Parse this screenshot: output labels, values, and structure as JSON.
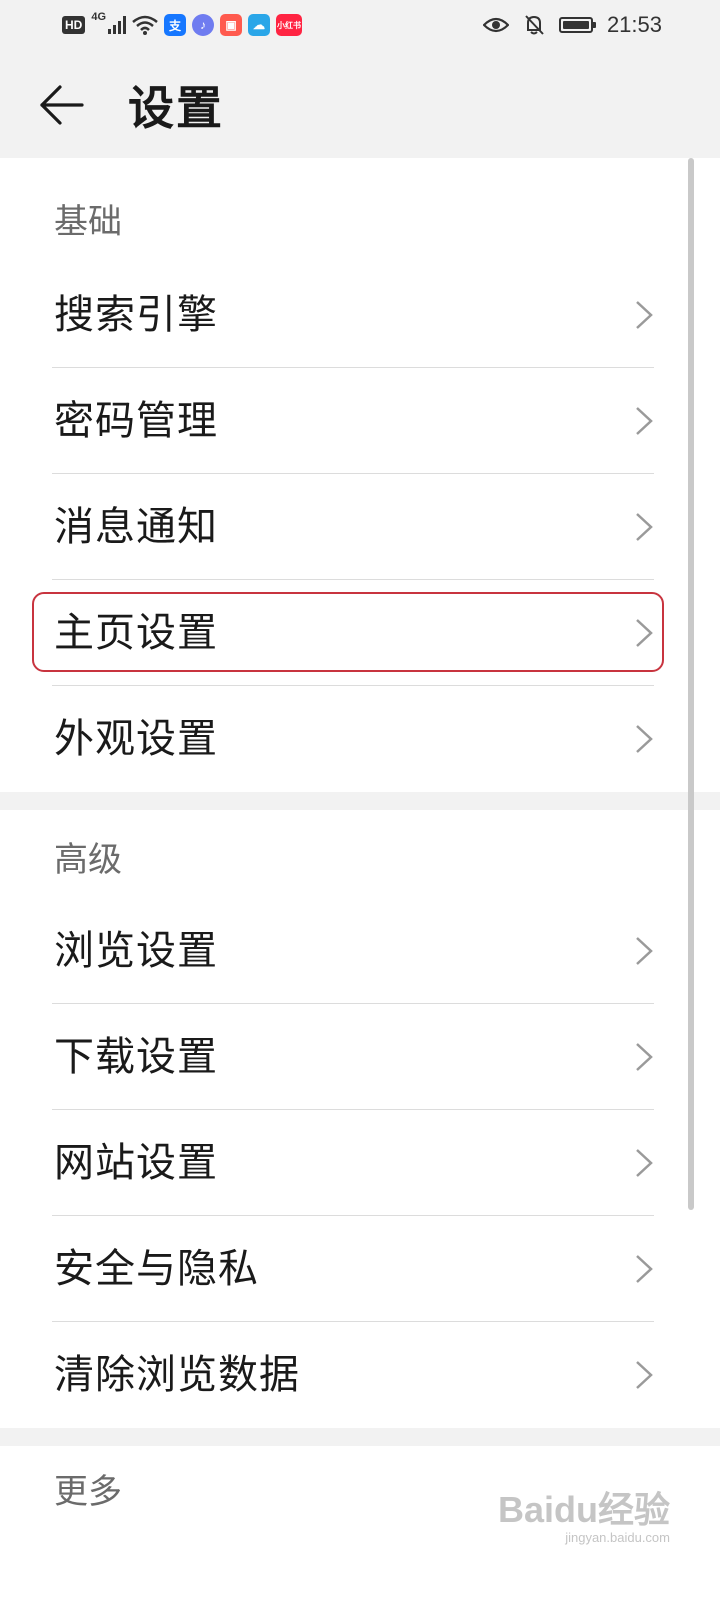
{
  "status_bar": {
    "hd": "HD",
    "network": "4G",
    "app_alipay": "支",
    "app_xiaohongshu": "小红书",
    "time": "21:53"
  },
  "header": {
    "title": "设置"
  },
  "sections": {
    "basic": {
      "label": "基础",
      "items": [
        "搜索引擎",
        "密码管理",
        "消息通知",
        "主页设置",
        "外观设置"
      ]
    },
    "advanced": {
      "label": "高级",
      "items": [
        "浏览设置",
        "下载设置",
        "网站设置",
        "安全与隐私",
        "清除浏览数据"
      ]
    },
    "more": {
      "label": "更多"
    }
  },
  "colors": {
    "highlight": "#c8343f",
    "background": "#f2f2f2"
  },
  "watermark": {
    "text": "Baidu经验",
    "sub": "jingyan.baidu.com"
  }
}
